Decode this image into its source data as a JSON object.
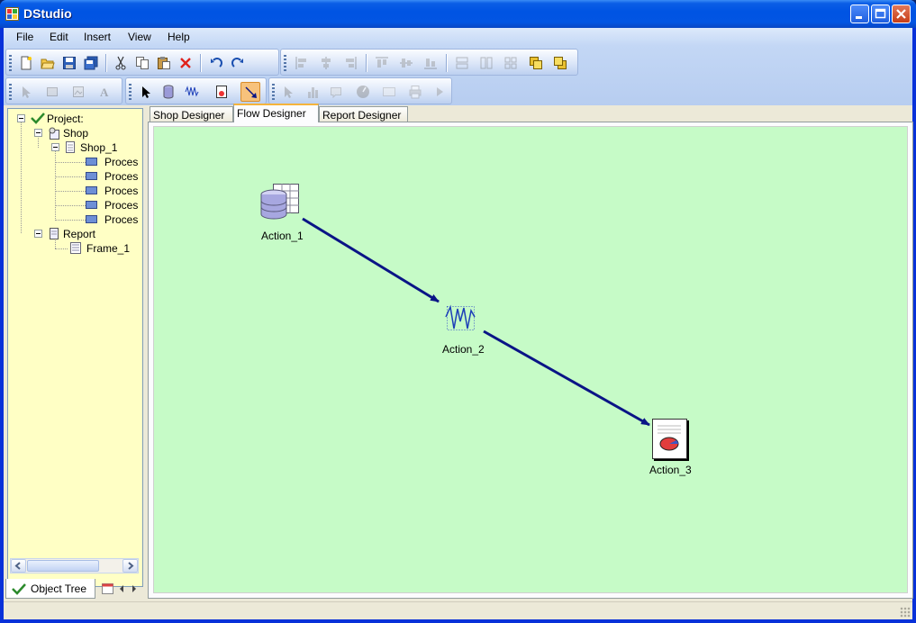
{
  "window": {
    "title": "DStudio"
  },
  "menu": [
    "File",
    "Edit",
    "Insert",
    "View",
    "Help"
  ],
  "toolbar1": {
    "file_buttons": [
      "new-file-icon",
      "open-folder-icon",
      "save-icon",
      "save-all-icon"
    ],
    "edit_buttons": [
      "cut-icon",
      "copy-icon",
      "paste-icon",
      "delete-icon"
    ],
    "history_buttons": [
      "undo-icon",
      "redo-icon"
    ],
    "align_buttons": [
      "align-left-icon",
      "align-center-icon",
      "align-right-icon",
      "align-top-icon",
      "align-middle-icon",
      "align-bottom-icon",
      "same-width-icon",
      "same-height-icon",
      "same-size-icon",
      "bring-front-icon",
      "send-back-icon"
    ]
  },
  "toolbar2": {
    "shop_tools": [
      "pointer-icon",
      "rectangle-icon",
      "image-icon",
      "text-icon"
    ],
    "flow_tools": [
      "pointer-icon",
      "database-icon",
      "wave-icon",
      "report-icon",
      "connector-arrow-icon"
    ],
    "report_tools": [
      "pointer-icon",
      "bar-chart-icon",
      "label-icon",
      "gauge-icon",
      "box-icon",
      "print-icon",
      "play-icon"
    ]
  },
  "tree": {
    "root": "Project:",
    "shop": "Shop",
    "shop_child": "Shop_1",
    "processes": [
      "Proces",
      "Proces",
      "Proces",
      "Proces",
      "Proces"
    ],
    "report": "Report",
    "report_child": "Frame_1"
  },
  "bottom_tab": {
    "label": "Object Tree"
  },
  "designer_tabs": [
    {
      "label": "Shop Designer"
    },
    {
      "label": "Flow Designer"
    },
    {
      "label": "Report Designer"
    }
  ],
  "active_tab": "Flow Designer",
  "flow": {
    "nodes": [
      {
        "label": "Action_1",
        "icon": "database-table-icon"
      },
      {
        "label": "Action_2",
        "icon": "waveform-icon"
      },
      {
        "label": "Action_3",
        "icon": "report-document-icon"
      }
    ],
    "connections": [
      [
        "Action_1",
        "Action_2"
      ],
      [
        "Action_2",
        "Action_3"
      ]
    ],
    "canvas_color": "#c6fbc7",
    "arrow_color": "#0a1486"
  }
}
